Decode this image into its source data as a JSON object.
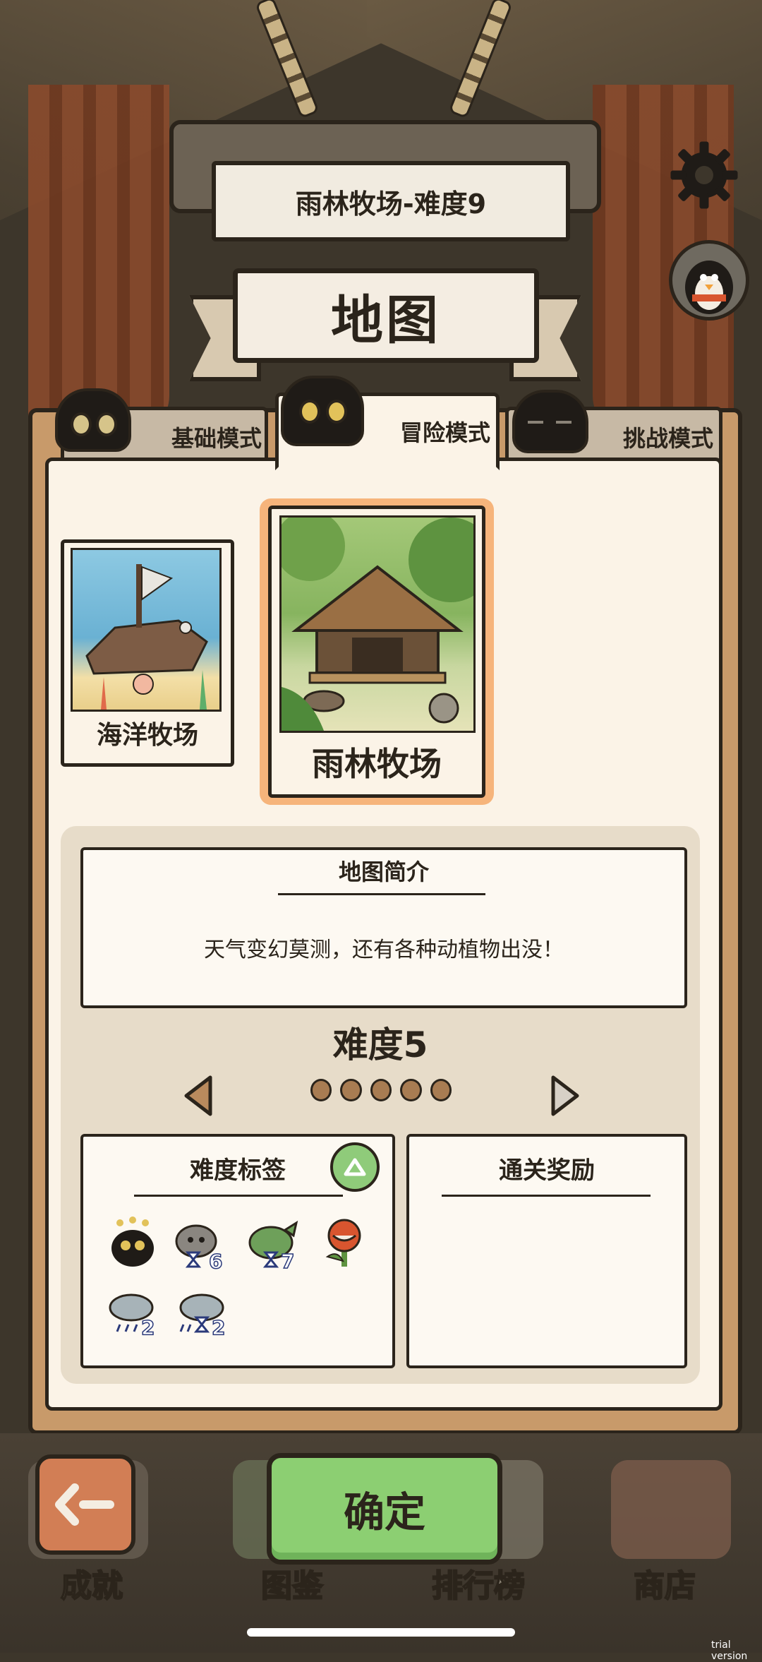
{
  "header": {
    "level_title": "雨林牧场-难度9",
    "map_title": "地图"
  },
  "tabs": [
    {
      "label": "基础模式",
      "active": false
    },
    {
      "label": "冒险模式",
      "active": true
    },
    {
      "label": "挑战模式",
      "active": false
    }
  ],
  "maps": [
    {
      "label": "海洋牧场",
      "selected": false
    },
    {
      "label": "雨林牧场",
      "selected": true
    }
  ],
  "intro": {
    "title": "地图简介",
    "text": "天气变幻莫测，还有各种动植物出没！"
  },
  "difficulty": {
    "label": "难度5",
    "dots_total": 5
  },
  "tags": {
    "title": "难度标签",
    "items": [
      {
        "icon": "black-cat-icon",
        "count": ""
      },
      {
        "icon": "gray-dog-timer-icon",
        "count": "6"
      },
      {
        "icon": "green-dragon-timer-icon",
        "count": "7"
      },
      {
        "icon": "piranha-flower-icon",
        "count": ""
      },
      {
        "icon": "rain-cloud-icon",
        "count": "2"
      },
      {
        "icon": "rain-cloud-timer-icon",
        "count": "2"
      }
    ]
  },
  "reward": {
    "title": "通关奖励"
  },
  "buttons": {
    "confirm": "确定"
  },
  "bottom_nav": [
    "成就",
    "图鉴",
    "排行榜",
    "商店"
  ],
  "watermark": "trial version",
  "colors": {
    "panel": "#c89a6a",
    "panel_inner": "#fbf3e7",
    "confirm": "#8ccf72",
    "back": "#d27e55",
    "selected_glow": "#f6b47b",
    "outline": "#2b241b"
  }
}
